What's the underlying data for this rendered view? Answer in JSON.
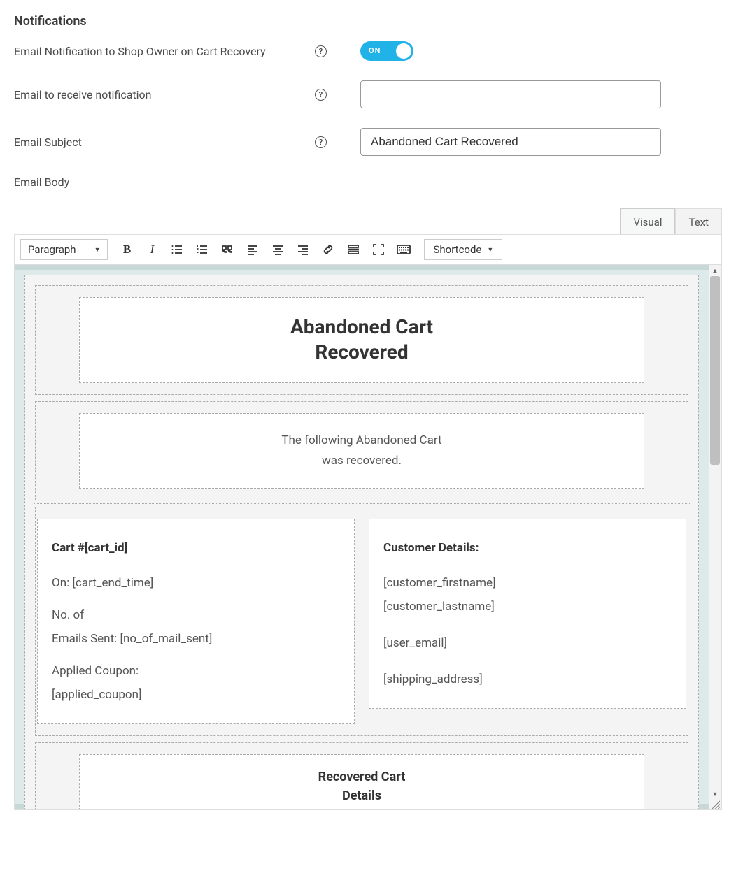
{
  "section_title": "Notifications",
  "rows": {
    "owner_notify": {
      "label": "Email Notification to Shop Owner on Cart Recovery",
      "toggle_text": "ON",
      "enabled": true
    },
    "email_to": {
      "label": "Email to receive notification",
      "value": ""
    },
    "subject": {
      "label": "Email Subject",
      "value": "Abandoned Cart Recovered"
    },
    "body": {
      "label": "Email Body"
    }
  },
  "editor": {
    "tabs": {
      "visual": "Visual",
      "text": "Text"
    },
    "format_select": "Paragraph",
    "shortcode_label": "Shortcode",
    "content": {
      "hero_title_l1": "Abandoned Cart",
      "hero_title_l2": "Recovered",
      "intro_l1": "The following Abandoned Cart",
      "intro_l2": "was recovered.",
      "left_head": "Cart #[cart_id]",
      "left_l1": "On: [cart_end_time]",
      "left_l2a": "No. of",
      "left_l2b": "Emails Sent: [no_of_mail_sent]",
      "left_l3a": "Applied Coupon:",
      "left_l3b": "[applied_coupon]",
      "right_head": "Customer Details:",
      "right_l1": "[customer_firstname]",
      "right_l2": "[customer_lastname]",
      "right_l3": "[user_email]",
      "right_l4": "[shipping_address]",
      "sub_l1": "Recovered Cart",
      "sub_l2": "Details"
    }
  }
}
